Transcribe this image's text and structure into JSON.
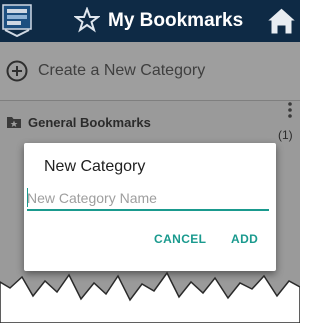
{
  "app_bar": {
    "title": "My Bookmarks",
    "icons": [
      "bookmarks-app-icon",
      "star-icon",
      "home-icon"
    ]
  },
  "create_category": {
    "label": "Create a New Category",
    "icon": "plus-circle-icon"
  },
  "categories": [
    {
      "name": "General Bookmarks",
      "count": "(1)",
      "icon": "folder-star-icon",
      "menu_icon": "more-vert-icon"
    }
  ],
  "dialog": {
    "title": "New Category",
    "input_value": "",
    "input_placeholder": "New Category Name",
    "cancel_label": "CANCEL",
    "add_label": "ADD"
  },
  "colors": {
    "app_bar": "#0e2a45",
    "accent": "#1a9a8e",
    "scrim": "#9a9a9a"
  }
}
